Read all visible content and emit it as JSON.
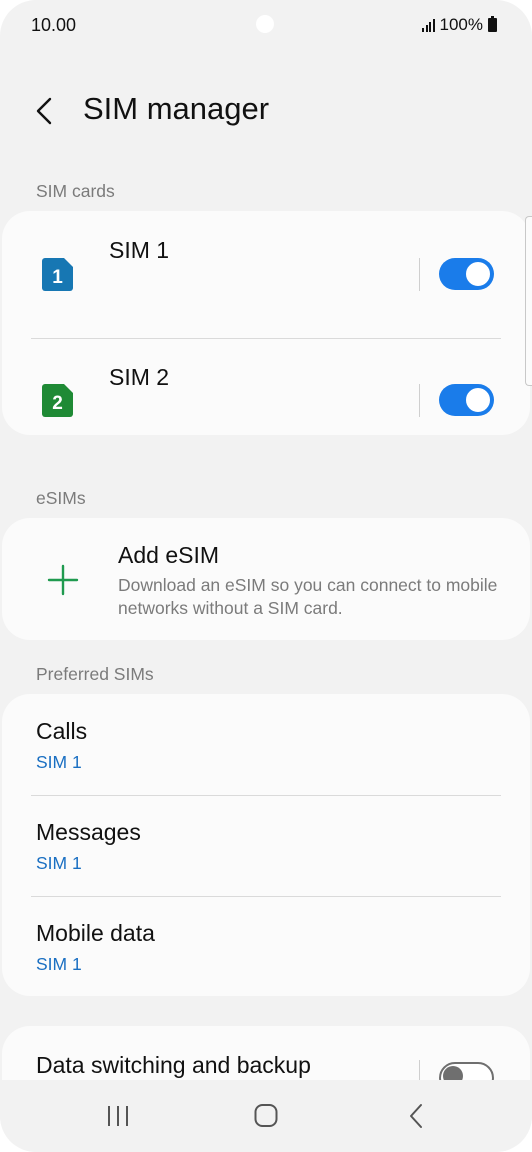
{
  "status": {
    "time": "10.00",
    "battery": "100%"
  },
  "header": {
    "title": "SIM manager",
    "back_icon": "back-arrow-icon"
  },
  "sim_cards": {
    "label": "SIM cards",
    "items": [
      {
        "number": "1",
        "name": "SIM 1",
        "color": "#1777b3",
        "enabled": true
      },
      {
        "number": "2",
        "name": "SIM 2",
        "color": "#1f8a35",
        "enabled": true
      }
    ]
  },
  "esims": {
    "label": "eSIMs",
    "add_title": "Add eSIM",
    "add_desc": "Download an eSIM so you can connect to mobile networks without a SIM card.",
    "plus_color": "#1f9a4f"
  },
  "preferred": {
    "label": "Preferred SIMs",
    "items": [
      {
        "title": "Calls",
        "value": "SIM 1"
      },
      {
        "title": "Messages",
        "value": "SIM 1"
      },
      {
        "title": "Mobile data",
        "value": "SIM 1"
      }
    ]
  },
  "data_switching": {
    "title": "Data switching and backup",
    "enabled": false
  },
  "colors": {
    "accent": "#1a7cea",
    "value_text": "#1a6fc2"
  }
}
